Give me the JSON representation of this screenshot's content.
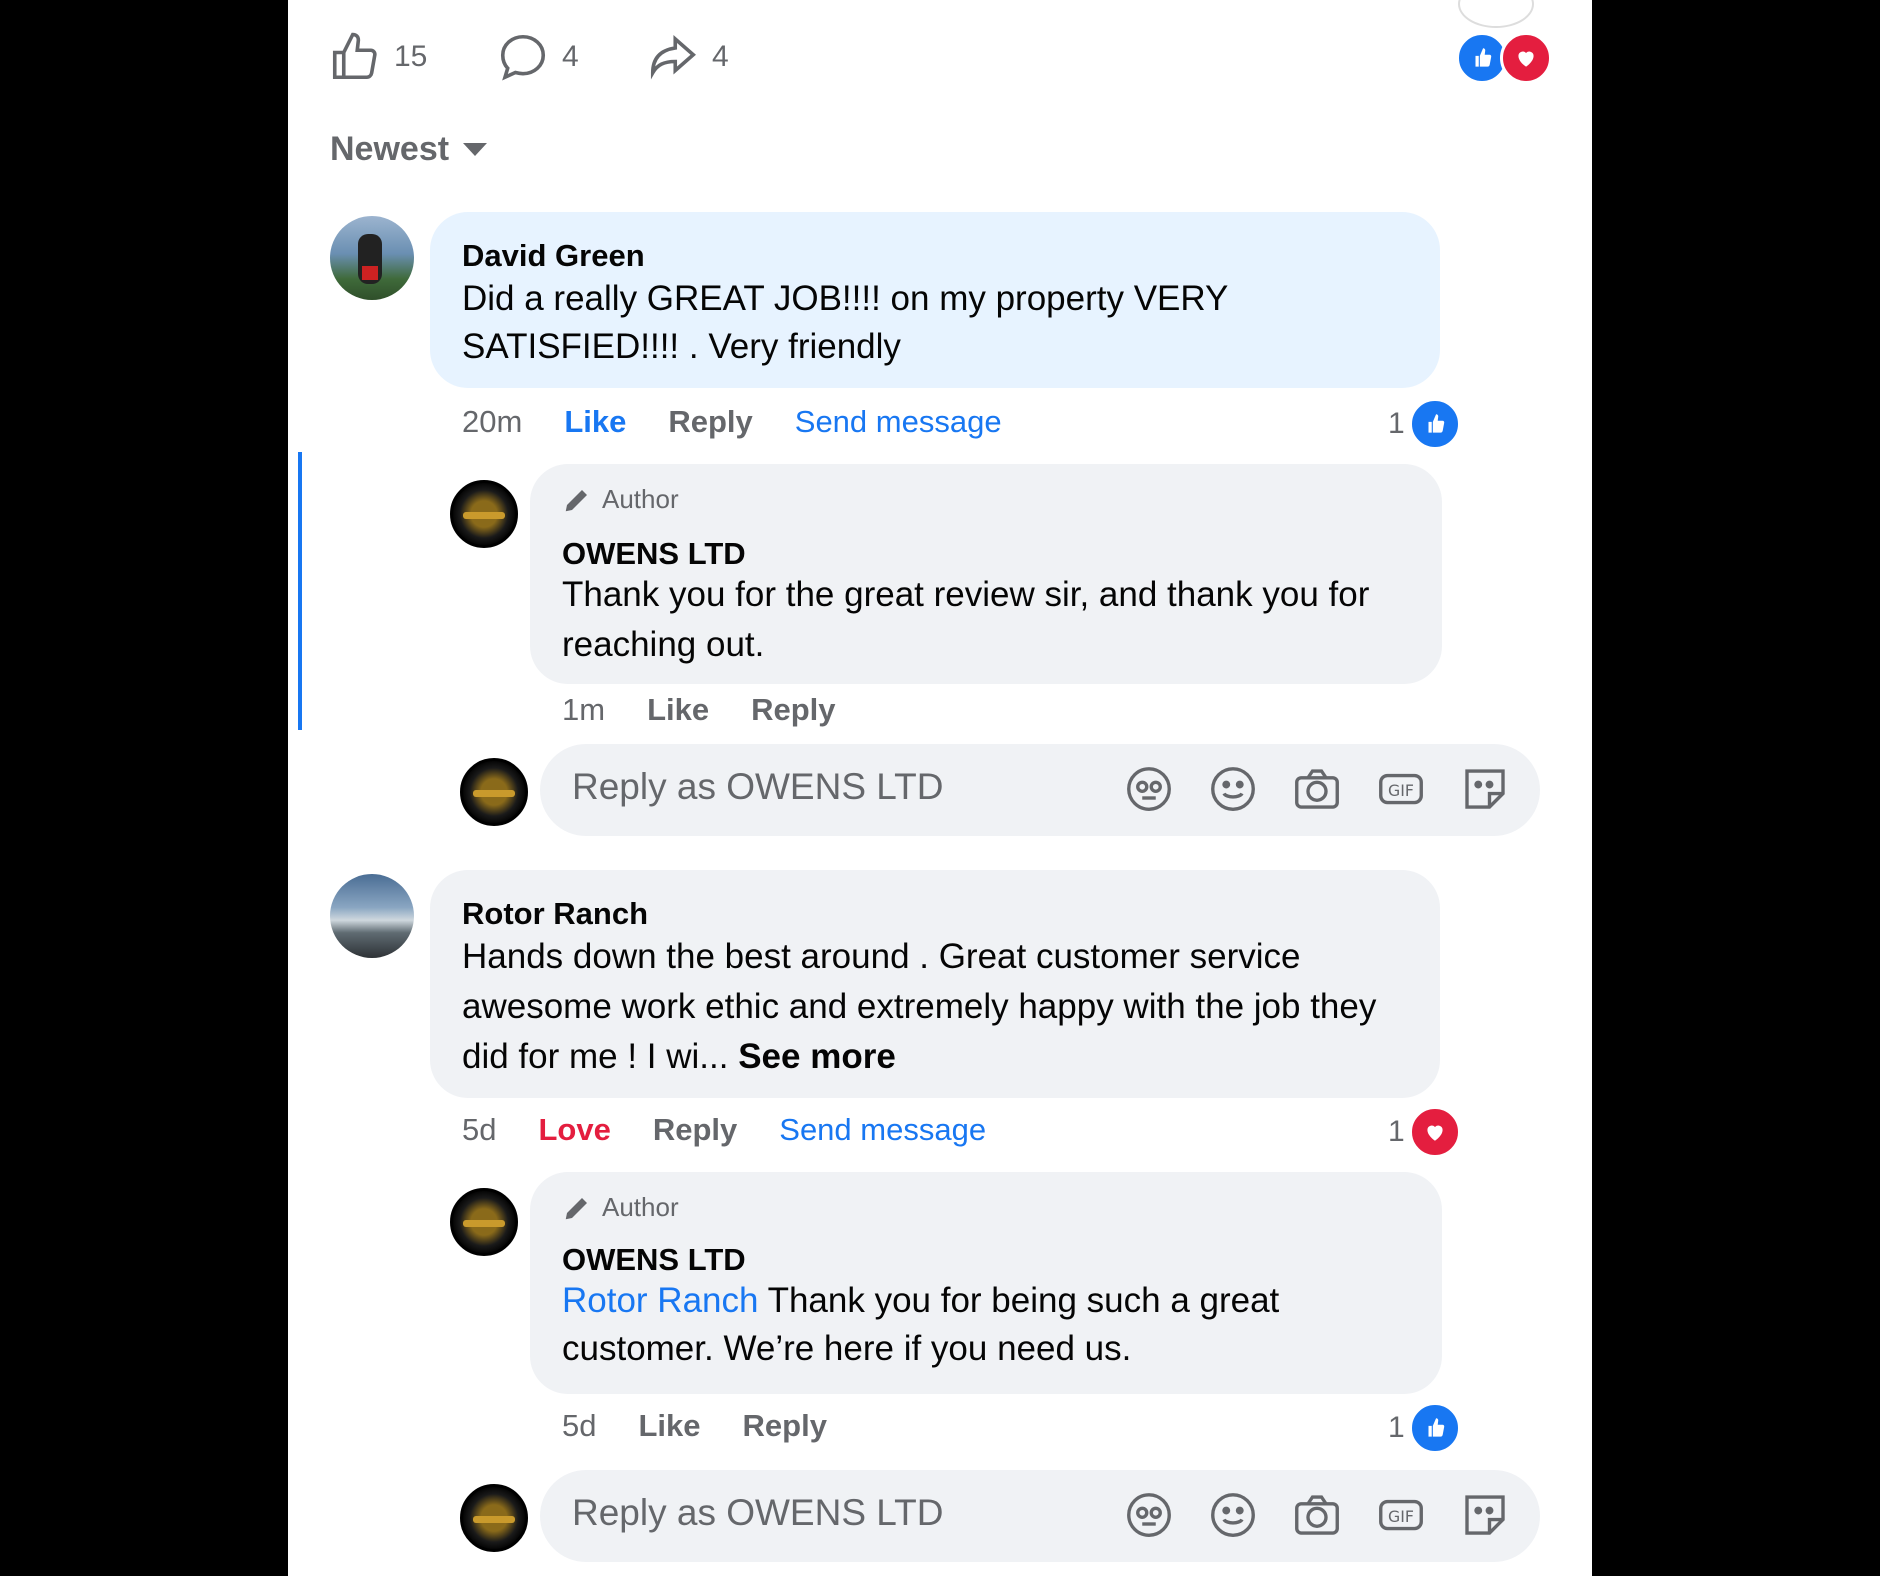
{
  "stats": {
    "likes": "15",
    "comments": "4",
    "shares": "4"
  },
  "sort": {
    "label": "Newest"
  },
  "icons": {
    "like": "thumbs-up-icon",
    "comment": "comment-bubble-icon",
    "share": "share-arrow-icon",
    "love": "heart-icon",
    "avatar_sticker": "avatar-sticker-icon",
    "emoji": "emoji-icon",
    "camera": "camera-icon",
    "gif": "gif-icon",
    "sticker": "sticker-icon",
    "pencil": "pencil-icon",
    "caret": "caret-down-icon"
  },
  "colors": {
    "blue": "#1877f2",
    "red": "#e41e3f",
    "bubble": "#f0f2f5",
    "highlight": "#e7f3ff"
  },
  "comments": [
    {
      "name": "David Green",
      "text_line1": "Did a really GREAT JOB!!!! on my property VERY",
      "text_line2": "SATISFIED!!!! . Very friendly",
      "time": "20m",
      "like": "Like",
      "reply": "Reply",
      "send": "Send message",
      "reaction_count": "1",
      "reply_item": {
        "author_badge": "Author",
        "name": "OWENS LTD",
        "text_line1": "Thank you for the great review sir, and thank you for",
        "text_line2": "reaching out.",
        "time": "1m",
        "like": "Like",
        "reply": "Reply"
      },
      "reply_input_placeholder": "Reply as OWENS LTD"
    },
    {
      "name": "Rotor Ranch",
      "text_line1": "Hands down the best around . Great customer service",
      "text_line2": "awesome work ethic and extremely happy with the job they",
      "text_line3": "did for me ! I wi...",
      "see_more": "See more",
      "time": "5d",
      "like": "Love",
      "reply": "Reply",
      "send": "Send message",
      "reaction_count": "1",
      "reply_item": {
        "author_badge": "Author",
        "name": "OWENS LTD",
        "mention": "Rotor Ranch",
        "text_line1": "Thank you for being such a great",
        "text_line2": "customer. We’re here if you need us.",
        "time": "5d",
        "like": "Like",
        "reply": "Reply",
        "reaction_count": "1"
      },
      "reply_input_placeholder": "Reply as OWENS LTD"
    }
  ]
}
